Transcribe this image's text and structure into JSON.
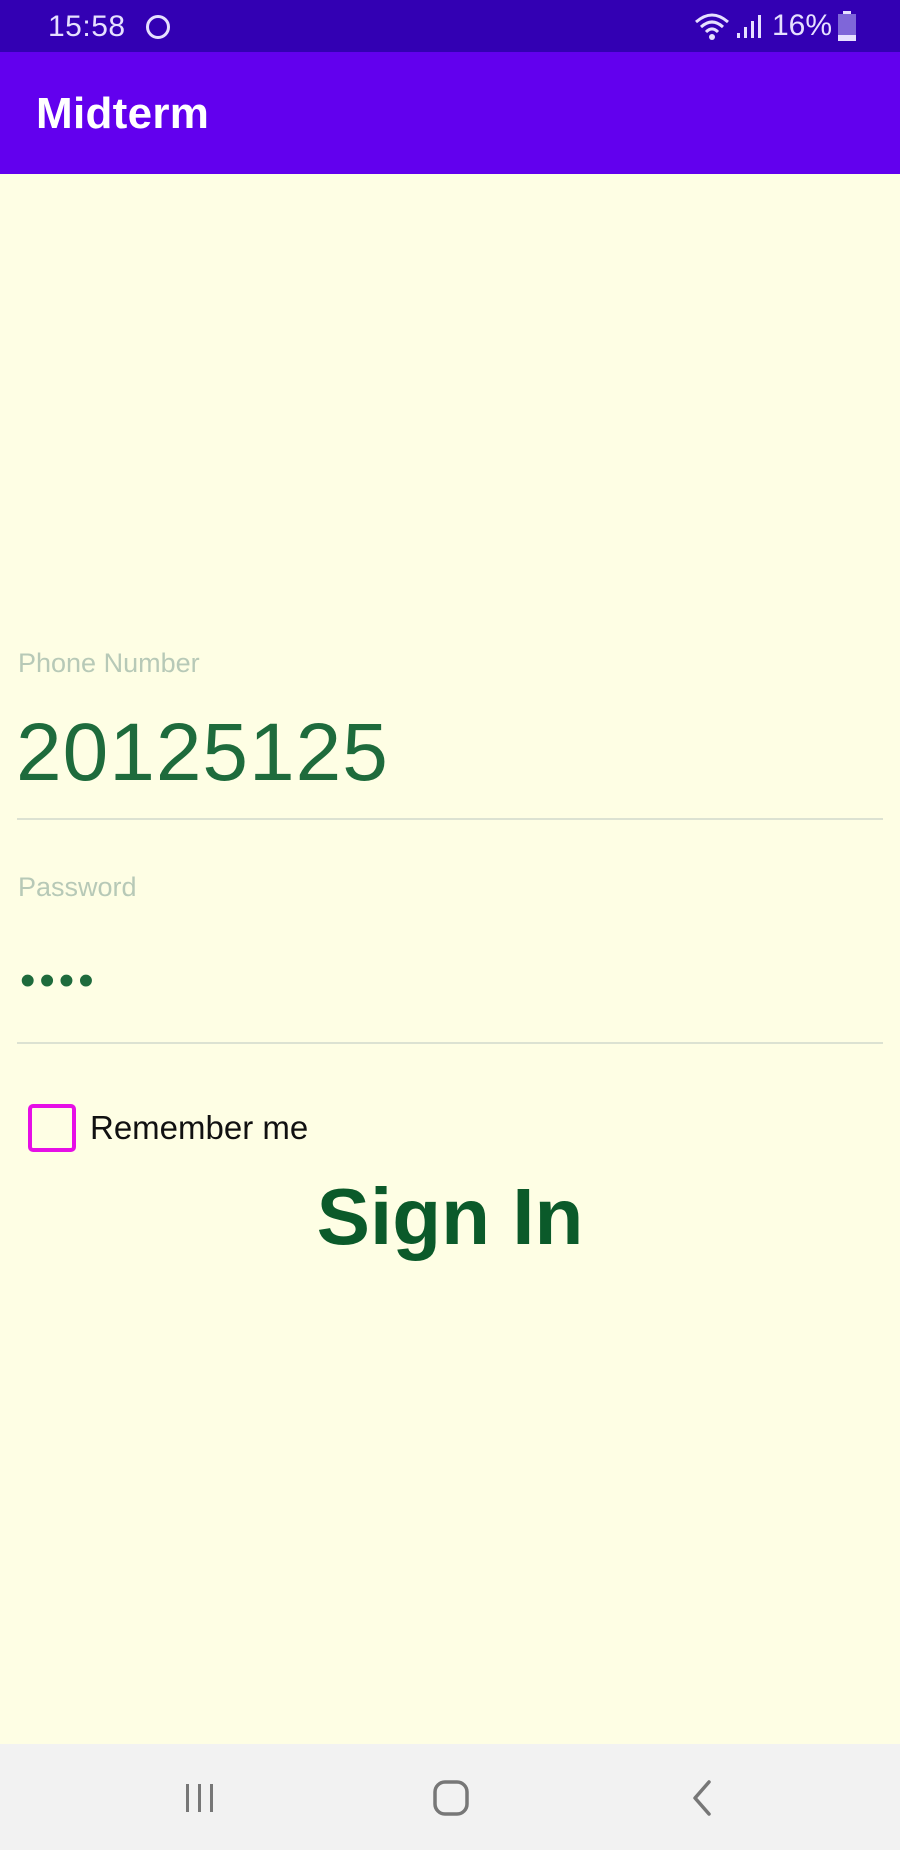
{
  "status_bar": {
    "time": "15:58",
    "battery_percent": "16%",
    "icons": [
      "circle-icon",
      "wifi-icon",
      "signal-icon",
      "battery-icon"
    ]
  },
  "app_bar": {
    "title": "Midterm",
    "color": "#6200EE"
  },
  "form": {
    "phone": {
      "label": "Phone Number",
      "value": "20125125"
    },
    "password": {
      "label": "Password",
      "value": "••••"
    },
    "remember_me": {
      "label": "Remember me",
      "checked": false,
      "color": "#E60FE6"
    },
    "sign_in_label": "Sign In"
  },
  "colors": {
    "background": "#FEFEE4",
    "status_bar": "#3300B3",
    "field_text": "#1E6B3C",
    "sign_in_text": "#0B5A2A"
  },
  "nav_bar": {
    "icons": [
      "recents-icon",
      "home-icon",
      "back-icon"
    ]
  }
}
